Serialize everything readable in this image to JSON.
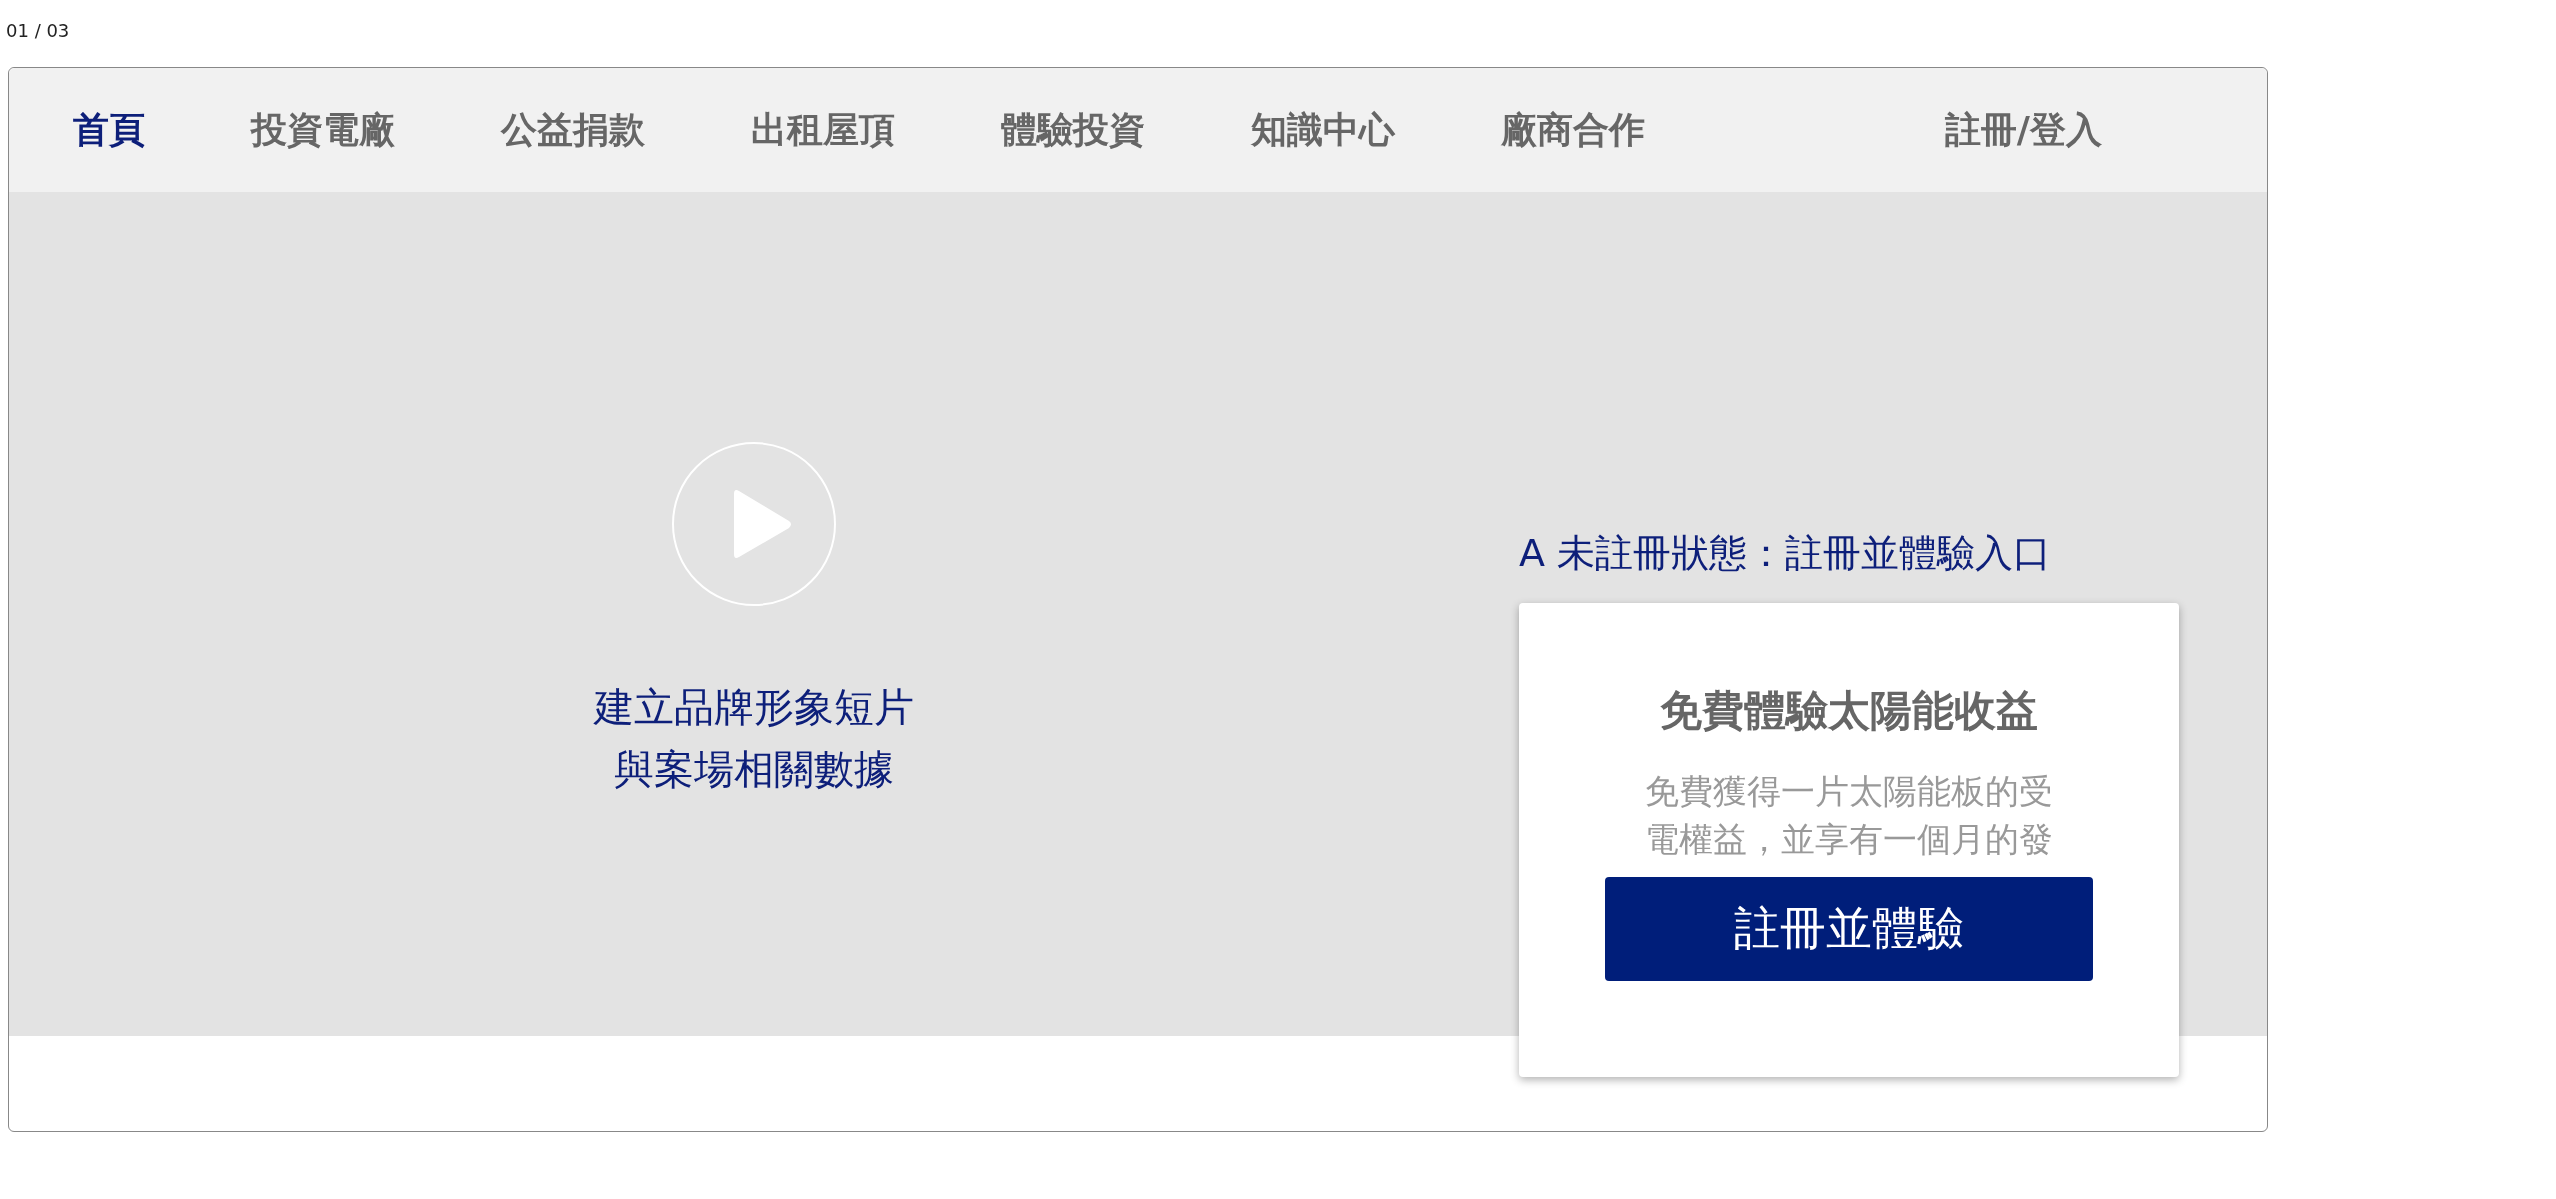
{
  "page_indicator": "01 / 03",
  "nav": {
    "items": [
      {
        "label": "首頁",
        "selected": true
      },
      {
        "label": "投資電廠",
        "selected": false
      },
      {
        "label": "公益捐款",
        "selected": false
      },
      {
        "label": "出租屋頂",
        "selected": false
      },
      {
        "label": "體驗投資",
        "selected": false
      },
      {
        "label": "知識中心",
        "selected": false
      },
      {
        "label": "廠商合作",
        "selected": false
      }
    ],
    "login": "註冊/登入"
  },
  "hero": {
    "video_caption": "建立品牌形象短片與案場相關數據",
    "state_label": "A 未註冊狀態：註冊並體驗入口",
    "card": {
      "title": "免費體驗太陽能收益",
      "description": "免費獲得一片太陽能板的受電權益，並享有一個月的發",
      "button": "註冊並體驗"
    }
  }
}
